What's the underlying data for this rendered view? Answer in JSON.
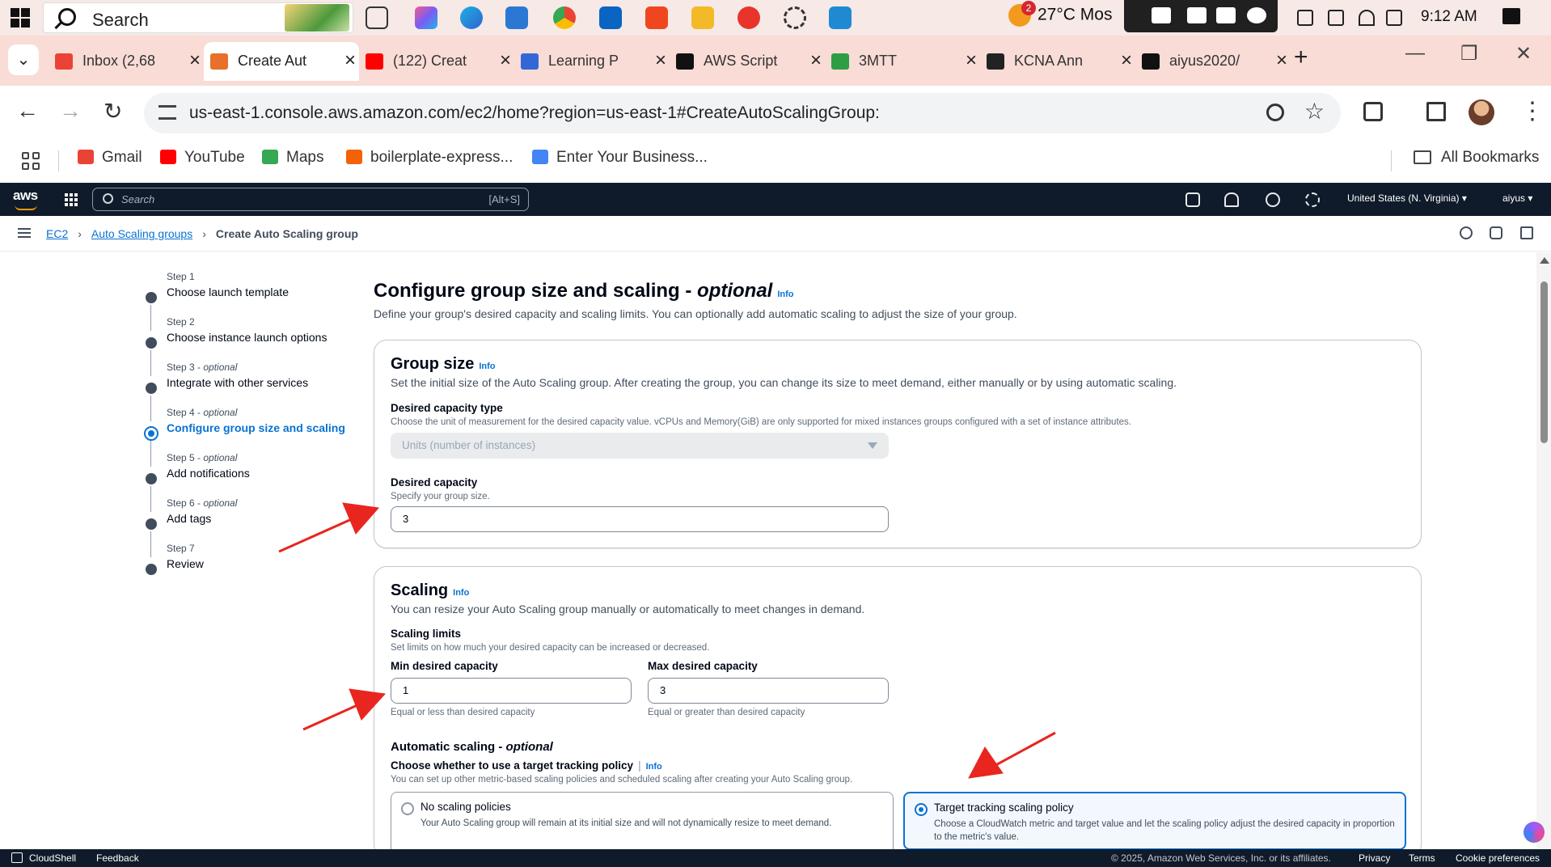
{
  "taskbar": {
    "search_label": "Search",
    "weather_temp": "27°C",
    "weather_text": "Mos",
    "weather_badge": "2",
    "clock": "9:12 AM"
  },
  "tabs": [
    {
      "title": "Inbox (2,68",
      "icon": "gmail-icon",
      "color": "#ea4335"
    },
    {
      "title": "Create Aut",
      "icon": "aws-icon",
      "color": "#e8702a",
      "active": true
    },
    {
      "title": "(122) Creat",
      "icon": "youtube-icon",
      "color": "#ff0000"
    },
    {
      "title": "Learning P",
      "icon": "learning-icon",
      "color": "#3367d6"
    },
    {
      "title": "AWS Script",
      "icon": "openai-icon",
      "color": "#111111"
    },
    {
      "title": "3MTT",
      "icon": "3mtt-icon",
      "color": "#2e9e44"
    },
    {
      "title": "KCNA Ann",
      "icon": "kcna-icon",
      "color": "#222222"
    },
    {
      "title": "aiyus2020/",
      "icon": "github-icon",
      "color": "#111111"
    }
  ],
  "address": {
    "url": "us-east-1.console.aws.amazon.com/ec2/home?region=us-east-1#CreateAutoScalingGroup:"
  },
  "bookmarks": [
    {
      "label": "Gmail",
      "icon": "gmail-icon",
      "color": "#ea4335"
    },
    {
      "label": "YouTube",
      "icon": "youtube-icon",
      "color": "#ff0000"
    },
    {
      "label": "Maps",
      "icon": "maps-icon",
      "color": "#34a853"
    },
    {
      "label": "boilerplate-express...",
      "icon": "replit-icon",
      "color": "#f26207"
    },
    {
      "label": "Enter Your Business...",
      "icon": "business-icon",
      "color": "#4285f4"
    }
  ],
  "all_bookmarks": "All Bookmarks",
  "aws_nav": {
    "search_placeholder": "Search",
    "search_shortcut": "[Alt+S]",
    "region": "United States (N. Virginia) ▾",
    "user": "aiyus ▾"
  },
  "breadcrumb": {
    "ec2": "EC2",
    "asg": "Auto Scaling groups",
    "current": "Create Auto Scaling group"
  },
  "steps": [
    {
      "num": "Step 1",
      "optional": "",
      "name": "Choose launch template"
    },
    {
      "num": "Step 2",
      "optional": "",
      "name": "Choose instance launch options"
    },
    {
      "num": "Step 3 - ",
      "optional": "optional",
      "name": "Integrate with other services"
    },
    {
      "num": "Step 4 - ",
      "optional": "optional",
      "name": "Configure group size and scaling",
      "active": true
    },
    {
      "num": "Step 5 - ",
      "optional": "optional",
      "name": "Add notifications"
    },
    {
      "num": "Step 6 - ",
      "optional": "optional",
      "name": "Add tags"
    },
    {
      "num": "Step 7",
      "optional": "",
      "name": "Review"
    }
  ],
  "page": {
    "title": "Configure group size and scaling - ",
    "title_optional": "optional",
    "info": "Info",
    "description": "Define your group's desired capacity and scaling limits. You can optionally add automatic scaling to adjust the size of your group."
  },
  "group_size": {
    "header": "Group size",
    "info": "Info",
    "description": "Set the initial size of the Auto Scaling group. After creating the group, you can change its size to meet demand, either manually or by using automatic scaling.",
    "capacity_type_label": "Desired capacity type",
    "capacity_type_hint": "Choose the unit of measurement for the desired capacity value. vCPUs and Memory(GiB) are only supported for mixed instances groups configured with a set of instance attributes.",
    "capacity_type_value": "Units (number of instances)",
    "desired_label": "Desired capacity",
    "desired_hint": "Specify your group size.",
    "desired_value": "3"
  },
  "scaling": {
    "header": "Scaling",
    "info": "Info",
    "description": "You can resize your Auto Scaling group manually or automatically to meet changes in demand.",
    "limits_label": "Scaling limits",
    "limits_hint": "Set limits on how much your desired capacity can be increased or decreased.",
    "min_label": "Min desired capacity",
    "min_value": "1",
    "min_hint": "Equal or less than desired capacity",
    "max_label": "Max desired capacity",
    "max_value": "3",
    "max_hint": "Equal or greater than desired capacity",
    "auto_label": "Automatic scaling - ",
    "auto_optional": "optional",
    "policy_label": "Choose whether to use a target tracking policy",
    "policy_info": "Info",
    "policy_hint": "You can set up other metric-based scaling policies and scheduled scaling after creating your Auto Scaling group.",
    "options": [
      {
        "title": "No scaling policies",
        "desc": "Your Auto Scaling group will remain at its initial size and will not dynamically resize to meet demand.",
        "selected": false
      },
      {
        "title": "Target tracking scaling policy",
        "desc": "Choose a CloudWatch metric and target value and let the scaling policy adjust the desired capacity in proportion to the metric's value.",
        "selected": true
      }
    ]
  },
  "footer": {
    "cloudshell": "CloudShell",
    "feedback": "Feedback",
    "copyright": "© 2025, Amazon Web Services, Inc. or its affiliates.",
    "privacy": "Privacy",
    "terms": "Terms",
    "cookies": "Cookie preferences"
  },
  "colors": {
    "accent": "#0972d3",
    "aws_nav": "#0f1b2a",
    "arrow": "#e8261f"
  }
}
